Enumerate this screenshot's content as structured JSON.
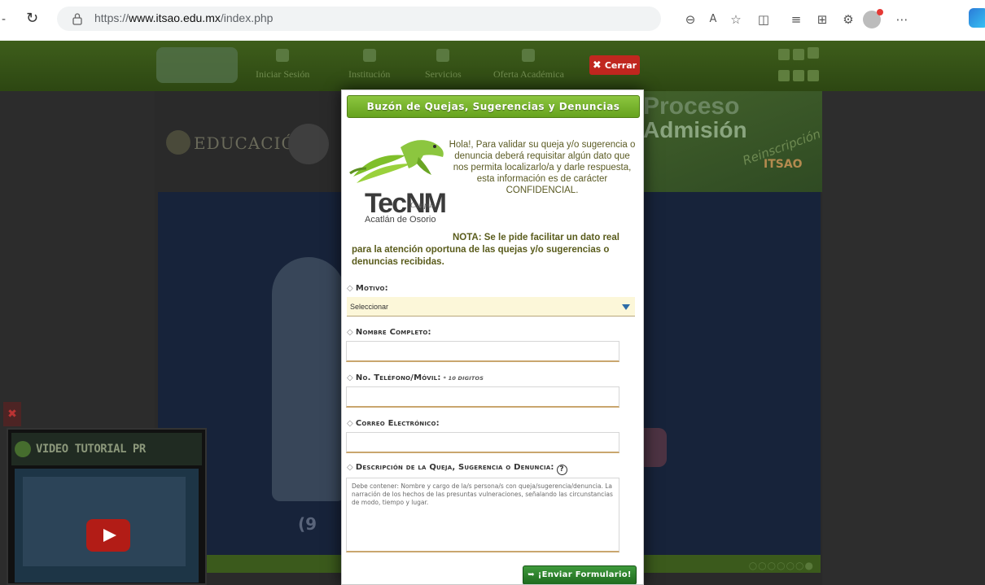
{
  "browser": {
    "url_prefix": "https://",
    "url_host": "www.itsao.edu.mx",
    "url_path": "/index.php"
  },
  "site": {
    "nav": [
      "Iniciar Sesión",
      "Institución",
      "Servicios",
      "Oferta Académica"
    ],
    "close_label": "Cerrar",
    "edu_banner": "EDUCACIÓN",
    "proceso_line1": "Proceso",
    "proceso_line2": "Admisión",
    "proceso_line3": "Reinscripción",
    "proceso_brand": "ITSAO",
    "phone_fragment": "(9",
    "video_title": "VIDEO TUTORIAL PR"
  },
  "modal": {
    "title": "Buzón de Quejas, Sugerencias y Denuncias",
    "logo_text": "TecNM",
    "logo_campus": "Campus",
    "logo_sub": "Acatlán de Osorio",
    "intro": "Hola!, Para validar su queja y/o sugerencia o denuncia deberá requisitar algún dato que nos permita localizarlo/a y darle respuesta, esta información es de carácter CONFIDENCIAL.",
    "note_lead": "NOTA: Se le pide facilitar un dato real",
    "note_rest": "para la atención oportuna de las quejas y/o sugerencias o denuncias recibidas.",
    "fields": {
      "motivo_label": "Motivo:",
      "motivo_value": "Seleccionar",
      "nombre_label": "Nombre Completo:",
      "telefono_label": "No. Teléfono/Móvil:",
      "telefono_hint": "* 10 DIGITOS",
      "correo_label": "Correo Electrónico:",
      "descripcion_label": "Descripción de la Queja, Sugerencia o Denuncia:",
      "descripcion_placeholder": "Debe contener: Nombre y cargo de la/s persona/s con queja/sugerencia/denuncia. La narración de los hechos de las presuntas vulneraciones, señalando las circunstancias de modo, tiempo y lugar."
    },
    "submit_label": "¡Enviar Formulario!"
  },
  "colors": {
    "accent_green": "#66a21e",
    "submit_green": "#2a7f2a",
    "close_red": "#c0271f",
    "caret_blue": "#2e6da8"
  }
}
